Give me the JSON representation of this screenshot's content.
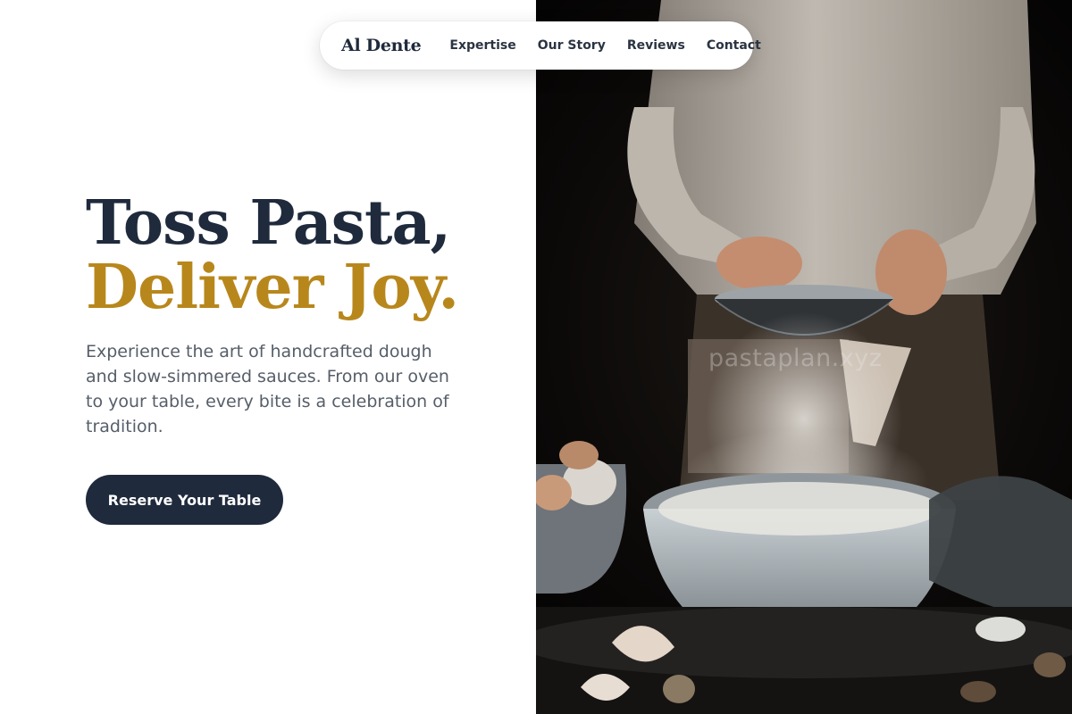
{
  "nav": {
    "logo": "Al Dente",
    "items": [
      {
        "label": "Expertise"
      },
      {
        "label": "Our Story"
      },
      {
        "label": "Reviews"
      },
      {
        "label": "Contact"
      }
    ]
  },
  "hero": {
    "headline_line1": "Toss Pasta,",
    "headline_line2": "Deliver Joy.",
    "description": "Experience the art of handcrafted dough and slow-simmered sauces. From our oven to your table, every bite is a celebration of tradition.",
    "cta_label": "Reserve Your Table"
  },
  "image": {
    "watermark": "pastaplan.xyz"
  },
  "colors": {
    "navy": "#1f2a3c",
    "gold": "#b8871c",
    "text_muted": "#565e69"
  }
}
